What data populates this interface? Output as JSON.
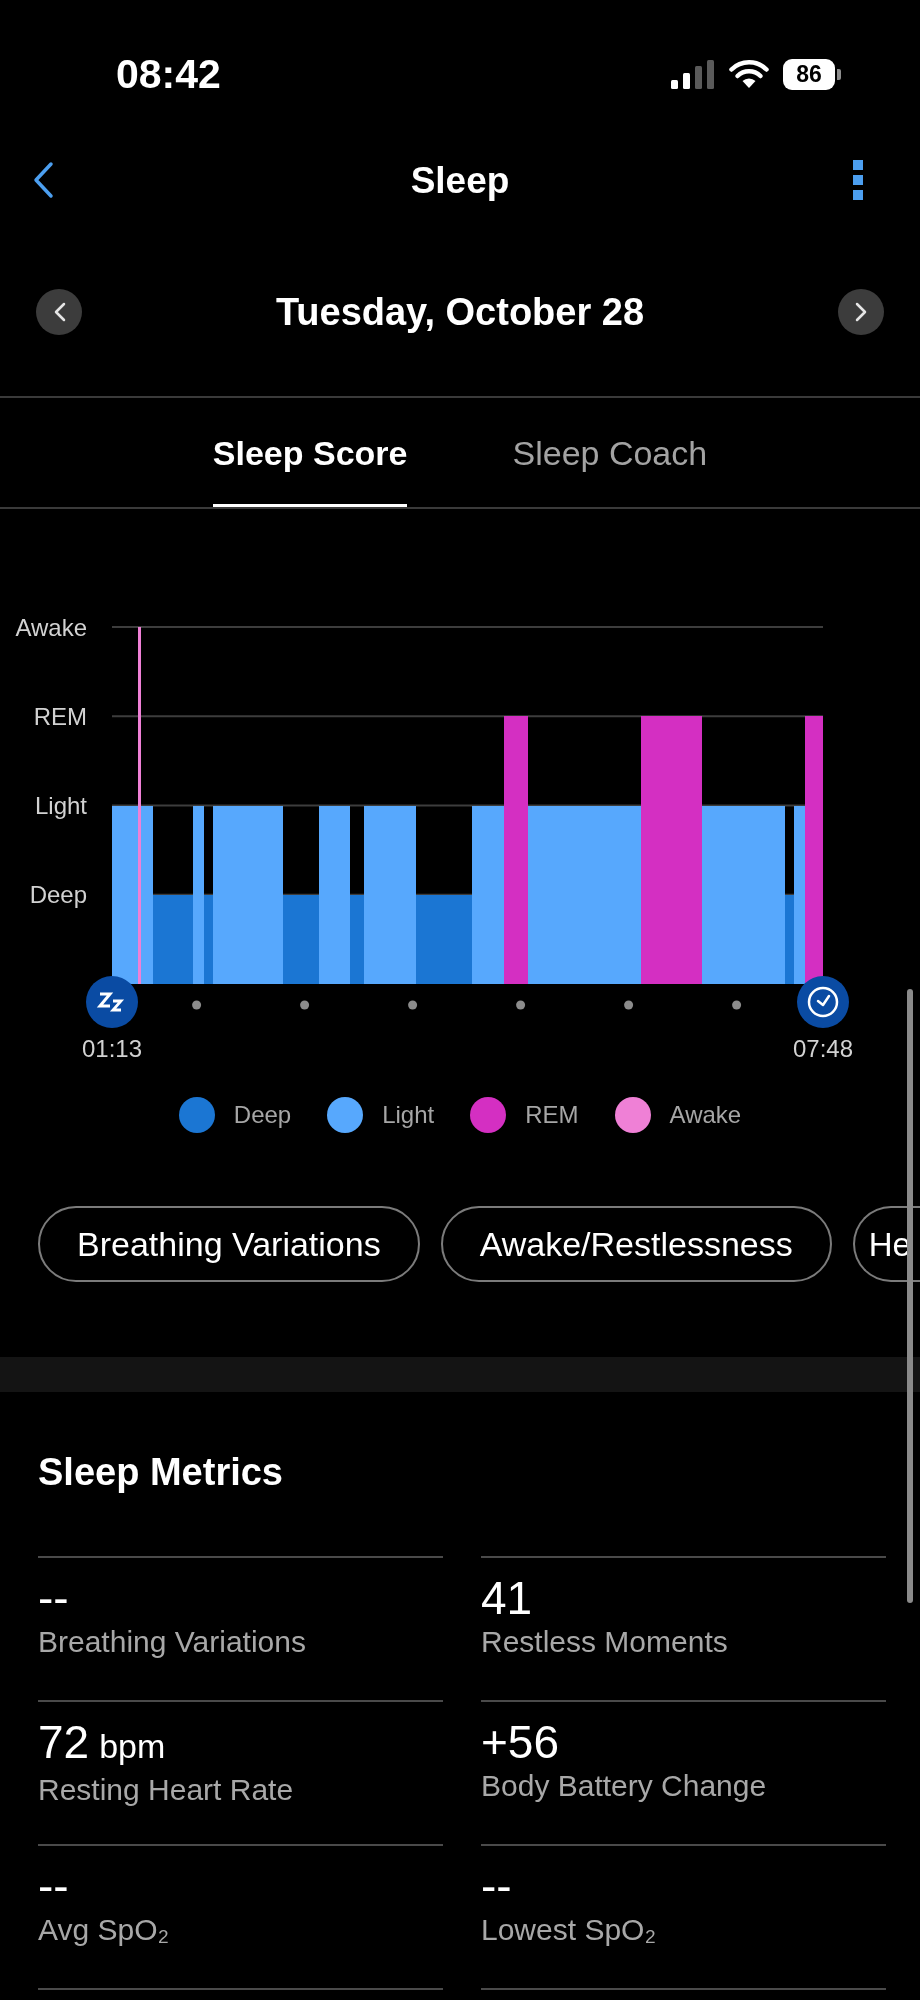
{
  "status_bar": {
    "time": "08:42",
    "battery": "86"
  },
  "header": {
    "title": "Sleep"
  },
  "date_nav": {
    "date": "Tuesday, October 28"
  },
  "tabs": [
    {
      "label": "Sleep Score",
      "selected": true
    },
    {
      "label": "Sleep Coach",
      "selected": false
    }
  ],
  "sleep_chart": {
    "y_axis": [
      "Awake",
      "REM",
      "Light",
      "Deep"
    ],
    "start_time": "01:13",
    "end_time": "07:48",
    "legend": [
      {
        "label": "Deep",
        "color": "#1b76d3"
      },
      {
        "label": "Light",
        "color": "#57a8fd"
      },
      {
        "label": "REM",
        "color": "#d42fc2"
      },
      {
        "label": "Awake",
        "color": "#ef80d6"
      }
    ]
  },
  "chips": [
    "Breathing Variations",
    "Awake/Restlessness",
    "He"
  ],
  "sleep_metrics": {
    "title": "Sleep Metrics",
    "items": [
      {
        "value": "--",
        "label": "Breathing Variations"
      },
      {
        "value": "41",
        "label": "Restless Moments"
      },
      {
        "value": "72",
        "unit": "bpm",
        "label": "Resting Heart Rate"
      },
      {
        "value": "+56",
        "label": "Body Battery Change"
      },
      {
        "value": "--",
        "label": "Avg SpO₂"
      },
      {
        "value": "--",
        "label": "Lowest SpO₂"
      }
    ]
  }
}
